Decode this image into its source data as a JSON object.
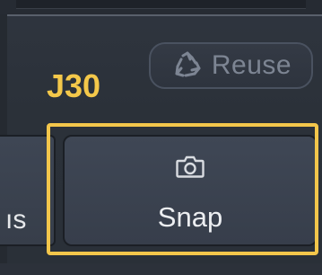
{
  "toolbar": {
    "reuse_label": "Reuse",
    "reuse_icon": "recycle-icon",
    "snap_label": "Snap",
    "snap_icon": "camera-icon",
    "partial_left_label": "ıs"
  },
  "annotation": {
    "label": "J30",
    "color": "#f3c64b"
  },
  "colors": {
    "background": "#2a3039",
    "button_face": "#3c4351",
    "button_text": "#eceef1",
    "disabled_text": "#7d8593",
    "highlight": "#f3c64b"
  }
}
